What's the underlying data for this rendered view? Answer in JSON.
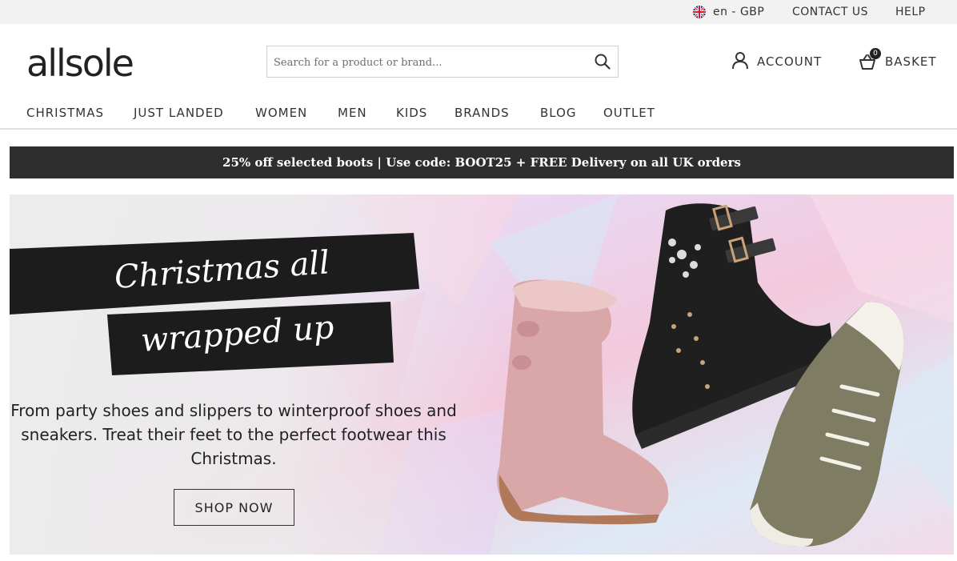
{
  "topbar": {
    "locale_label": "en - GBP",
    "contact_label": "CONTACT US",
    "help_label": "HELP"
  },
  "header": {
    "logo_text": "allsole",
    "search_placeholder": "Search for a product or brand...",
    "account_label": "ACCOUNT",
    "basket_label": "BASKET",
    "basket_count": "0"
  },
  "nav": {
    "items": [
      "CHRISTMAS",
      "JUST LANDED",
      "WOMEN",
      "MEN",
      "KIDS",
      "BRANDS",
      "BLOG",
      "OUTLET"
    ]
  },
  "promo": {
    "text": "25% off selected boots | Use code: BOOT25 + FREE Delivery on all UK orders"
  },
  "hero": {
    "headline_line1": "Christmas all",
    "headline_line2": "wrapped up",
    "body": "From party shoes and slippers to winterproof shoes and sneakers. Treat their feet to the perfect footwear this Christmas.",
    "cta_label": "SHOP NOW"
  },
  "colors": {
    "topbar_bg": "#f2f2f2",
    "promo_bg": "#2e2e2e",
    "text": "#222222"
  }
}
